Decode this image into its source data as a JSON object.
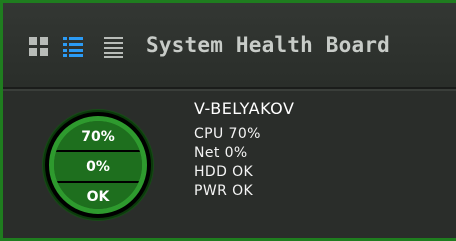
{
  "header": {
    "title": "System Health Board",
    "views": [
      {
        "name": "grid",
        "icon": "grid-view-icon"
      },
      {
        "name": "list",
        "icon": "list-view-icon",
        "active": true
      },
      {
        "name": "lines",
        "icon": "lines-view-icon"
      }
    ]
  },
  "gauge": {
    "rows": [
      "70%",
      "0%",
      "OK"
    ]
  },
  "machine": {
    "name": "V-BELYAKOV",
    "stats": [
      "CPU 70%",
      "Net 0%",
      "HDD OK",
      "PWR OK"
    ]
  },
  "colors": {
    "accent_green": "#1f7d1f",
    "ring_green": "#2e9a2e",
    "active_blue": "#2b9bf5",
    "background": "#2a2d2a"
  }
}
